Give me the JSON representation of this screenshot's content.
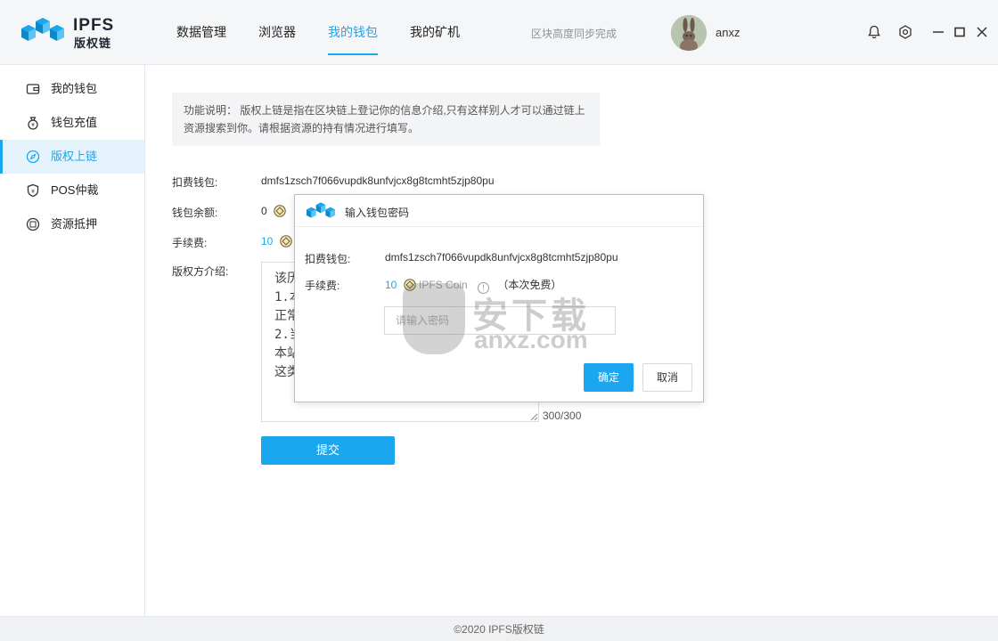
{
  "app": {
    "logo_title": "IPFS",
    "logo_subtitle": "版权链",
    "sync_status": "区块高度同步完成",
    "username": "anxz"
  },
  "nav": [
    {
      "label": "数据管理",
      "active": false
    },
    {
      "label": "浏览器",
      "active": false
    },
    {
      "label": "我的钱包",
      "active": true
    },
    {
      "label": "我的矿机",
      "active": false
    }
  ],
  "sidebar": [
    {
      "label": "我的钱包",
      "icon": "wallet-icon",
      "active": false
    },
    {
      "label": "钱包充值",
      "icon": "moneybag-icon",
      "active": false
    },
    {
      "label": "版权上链",
      "icon": "compass-icon",
      "active": true
    },
    {
      "label": "POS仲裁",
      "icon": "shield-icon",
      "active": false
    },
    {
      "label": "资源抵押",
      "icon": "pledge-icon",
      "active": false
    }
  ],
  "main": {
    "notice_line1": "功能说明：  版权上链是指在区块链上登记你的信息介绍,只有这样别人才可以通过链上",
    "notice_line2": "资源搜索到你。请根据资源的持有情况进行填写。",
    "wallet_label": "扣费钱包:",
    "wallet_value": "dmfs1zsch7f066vupdk8unfvjcx8g8tcmht5zjp80pu",
    "balance_label": "钱包余额:",
    "balance_value": "0",
    "fee_label": "手续费:",
    "fee_value": "10",
    "intro_label": "版权方介绍:",
    "intro_text": "该历\n1.本\n正常\n2.当\n本站\n这类",
    "char_counter": "300/300",
    "submit_label": "提交"
  },
  "dialog": {
    "title": "输入钱包密码",
    "wallet_label": "扣费钱包:",
    "wallet_value": "dmfs1zsch7f066vupdk8unfvjcx8g8tcmht5zjp80pu",
    "fee_label": "手续费:",
    "fee_value": "10",
    "coin_name": "IPFS Coin",
    "fee_note": "（本次免费）",
    "password_placeholder": "请输入密码",
    "confirm_label": "确定",
    "cancel_label": "取消"
  },
  "watermark": {
    "text1": "安下载",
    "text2": "anxz.com"
  },
  "footer": "©2020 IPFS版权链",
  "colors": {
    "accent": "#1ba7f0",
    "header_bg": "#f4f6f8",
    "active_bg": "#e4f3fc"
  }
}
